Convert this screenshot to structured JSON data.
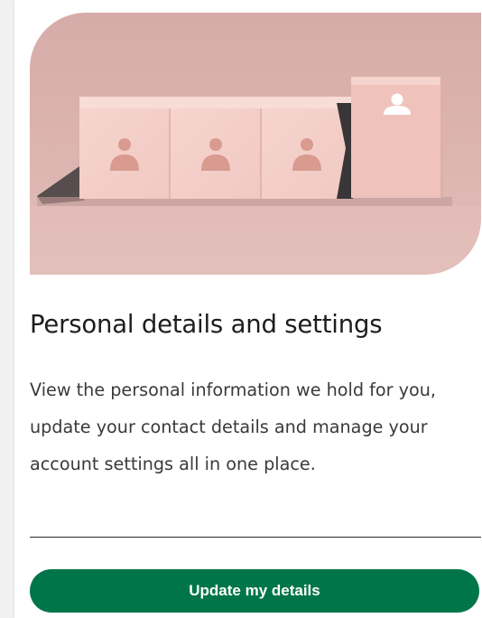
{
  "card": {
    "title": "Personal details and settings",
    "description": "View the personal information we hold for you, update your contact details and manage your account settings all in one place.",
    "button_label": "Update my details"
  },
  "colors": {
    "button": "#00754a",
    "hero_background": "#d8b0ac"
  },
  "hero": {
    "icon": "person-icon",
    "blocks": 4
  }
}
